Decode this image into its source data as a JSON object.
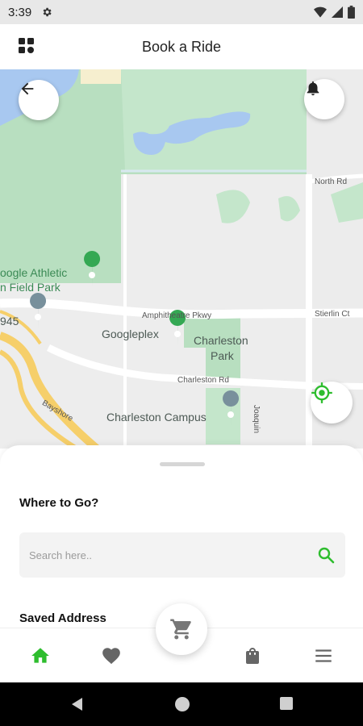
{
  "status_bar": {
    "time": "3:39"
  },
  "app_bar": {
    "title": "Book a Ride"
  },
  "map": {
    "labels": {
      "google_athletic_1": "oogle Athletic",
      "google_athletic_2": "n Field Park",
      "googleplex": "Googleplex",
      "charleston_park_1": "Charleston",
      "charleston_park_2": "Park",
      "charleston_campus": "Charleston Campus",
      "amphitheatre": "Amphitheatre Pkwy",
      "charleston_rd": "Charleston Rd",
      "north_rd": "North Rd",
      "stierlin_ct": "Stierlin Ct",
      "bayshore": "Bayshore",
      "joaquin": "Joaquin",
      "route_945": "945"
    }
  },
  "sheet": {
    "where_title": "Where to Go?",
    "search_placeholder": "Search here..",
    "saved_title": "Saved Address"
  },
  "colors": {
    "accent": "#2ebd2e",
    "park_green": "#b8dfc0",
    "water": "#a8c8f0"
  },
  "icons": {
    "menu": "grid-icon",
    "back": "arrow-back-icon",
    "notification": "bell-icon",
    "locate": "gps-target-icon",
    "search": "search-icon",
    "cart": "cart-icon",
    "home": "home-icon",
    "favorite": "heart-icon",
    "bag": "shopping-bag-icon",
    "menu_lines": "hamburger-icon"
  }
}
